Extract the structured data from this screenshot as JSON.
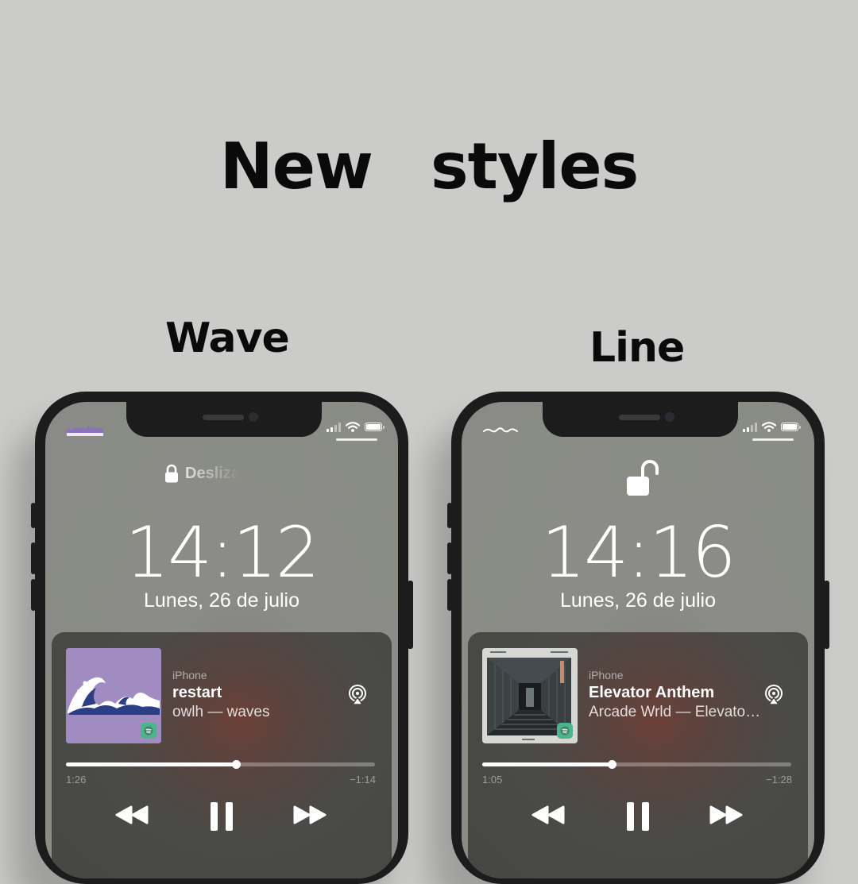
{
  "heading": {
    "word1": "New",
    "word2": "styles"
  },
  "phones": [
    {
      "style_label": "Wave",
      "lock_hint": "Desliza",
      "time": "14:12",
      "date": "Lunes, 26 de julio",
      "player": {
        "device": "iPhone",
        "song": "restart",
        "artist": "owlh — waves",
        "elapsed": "1:26",
        "remaining": "−1:14",
        "progress": 0.55,
        "art_color": "#a08cc0"
      },
      "carrier_icon": "wave-icon"
    },
    {
      "style_label": "Line",
      "time": "14:16",
      "date": "Lunes, 26 de julio",
      "player": {
        "device": "iPhone",
        "song": "Elevator Anthem",
        "artist": "Arcade Wrld — Elevator Anthem",
        "elapsed": "1:05",
        "remaining": "−1:28",
        "progress": 0.42,
        "art_color": "#3a3d3e"
      },
      "carrier_icon": "line-icon"
    }
  ],
  "colors": {
    "background": "#cbcbc9",
    "spotify_green": "#4cb38b",
    "wave_purple": "#8a72bd"
  }
}
